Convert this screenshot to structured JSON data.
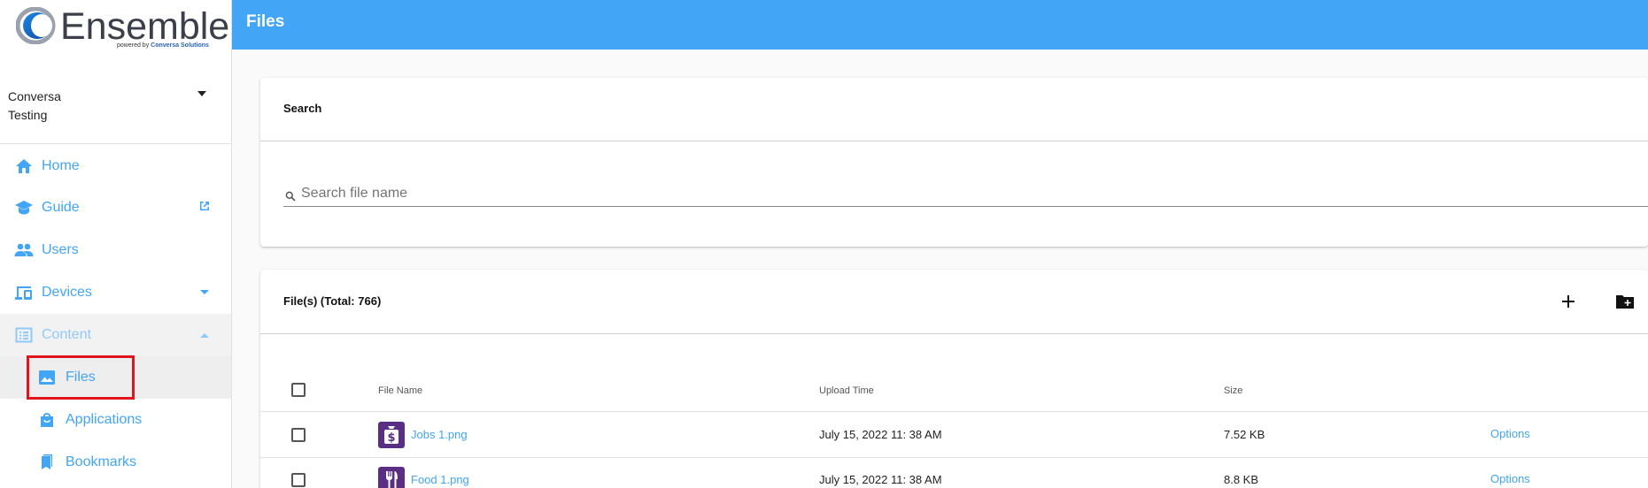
{
  "brand": {
    "name": "Ensemble",
    "powered_by_prefix": "powered by",
    "powered_by_company": "Conversa Solutions"
  },
  "org": {
    "line1": "Conversa",
    "line2": "Testing"
  },
  "sidebar": {
    "items": [
      {
        "label": "Home",
        "icon": "home-icon"
      },
      {
        "label": "Guide",
        "icon": "school-icon",
        "trail_icon": "open-in-new-icon"
      },
      {
        "label": "Users",
        "icon": "people-icon"
      },
      {
        "label": "Devices",
        "icon": "devices-icon",
        "trail_icon": "chevron-down-icon"
      },
      {
        "label": "Content",
        "icon": "list-alt-icon",
        "trail_icon": "chevron-up-icon"
      },
      {
        "label": "Files",
        "icon": "image-icon"
      },
      {
        "label": "Applications",
        "icon": "shopping-bag-icon"
      },
      {
        "label": "Bookmarks",
        "icon": "bookmarks-icon"
      }
    ]
  },
  "header": {
    "title": "Files"
  },
  "search": {
    "title": "Search",
    "placeholder": "Search file name",
    "value": ""
  },
  "files": {
    "title": "File(s) (Total: 766)",
    "columns": {
      "name": "File Name",
      "upload_time": "Upload Time",
      "size": "Size"
    },
    "rows": [
      {
        "name": "Jobs 1.png",
        "upload_time": "July 15, 2022 11: 38 AM",
        "size": "7.52 KB",
        "action": "Options",
        "thumb_icon": "money-bag-icon"
      },
      {
        "name": "Food 1.png",
        "upload_time": "July 15, 2022 11: 38 AM",
        "size": "8.8 KB",
        "action": "Options",
        "thumb_icon": "fork-knife-icon"
      }
    ]
  },
  "colors": {
    "accent": "#42a5f5",
    "highlight": "#e0141c",
    "thumb": "#5a2e82"
  }
}
